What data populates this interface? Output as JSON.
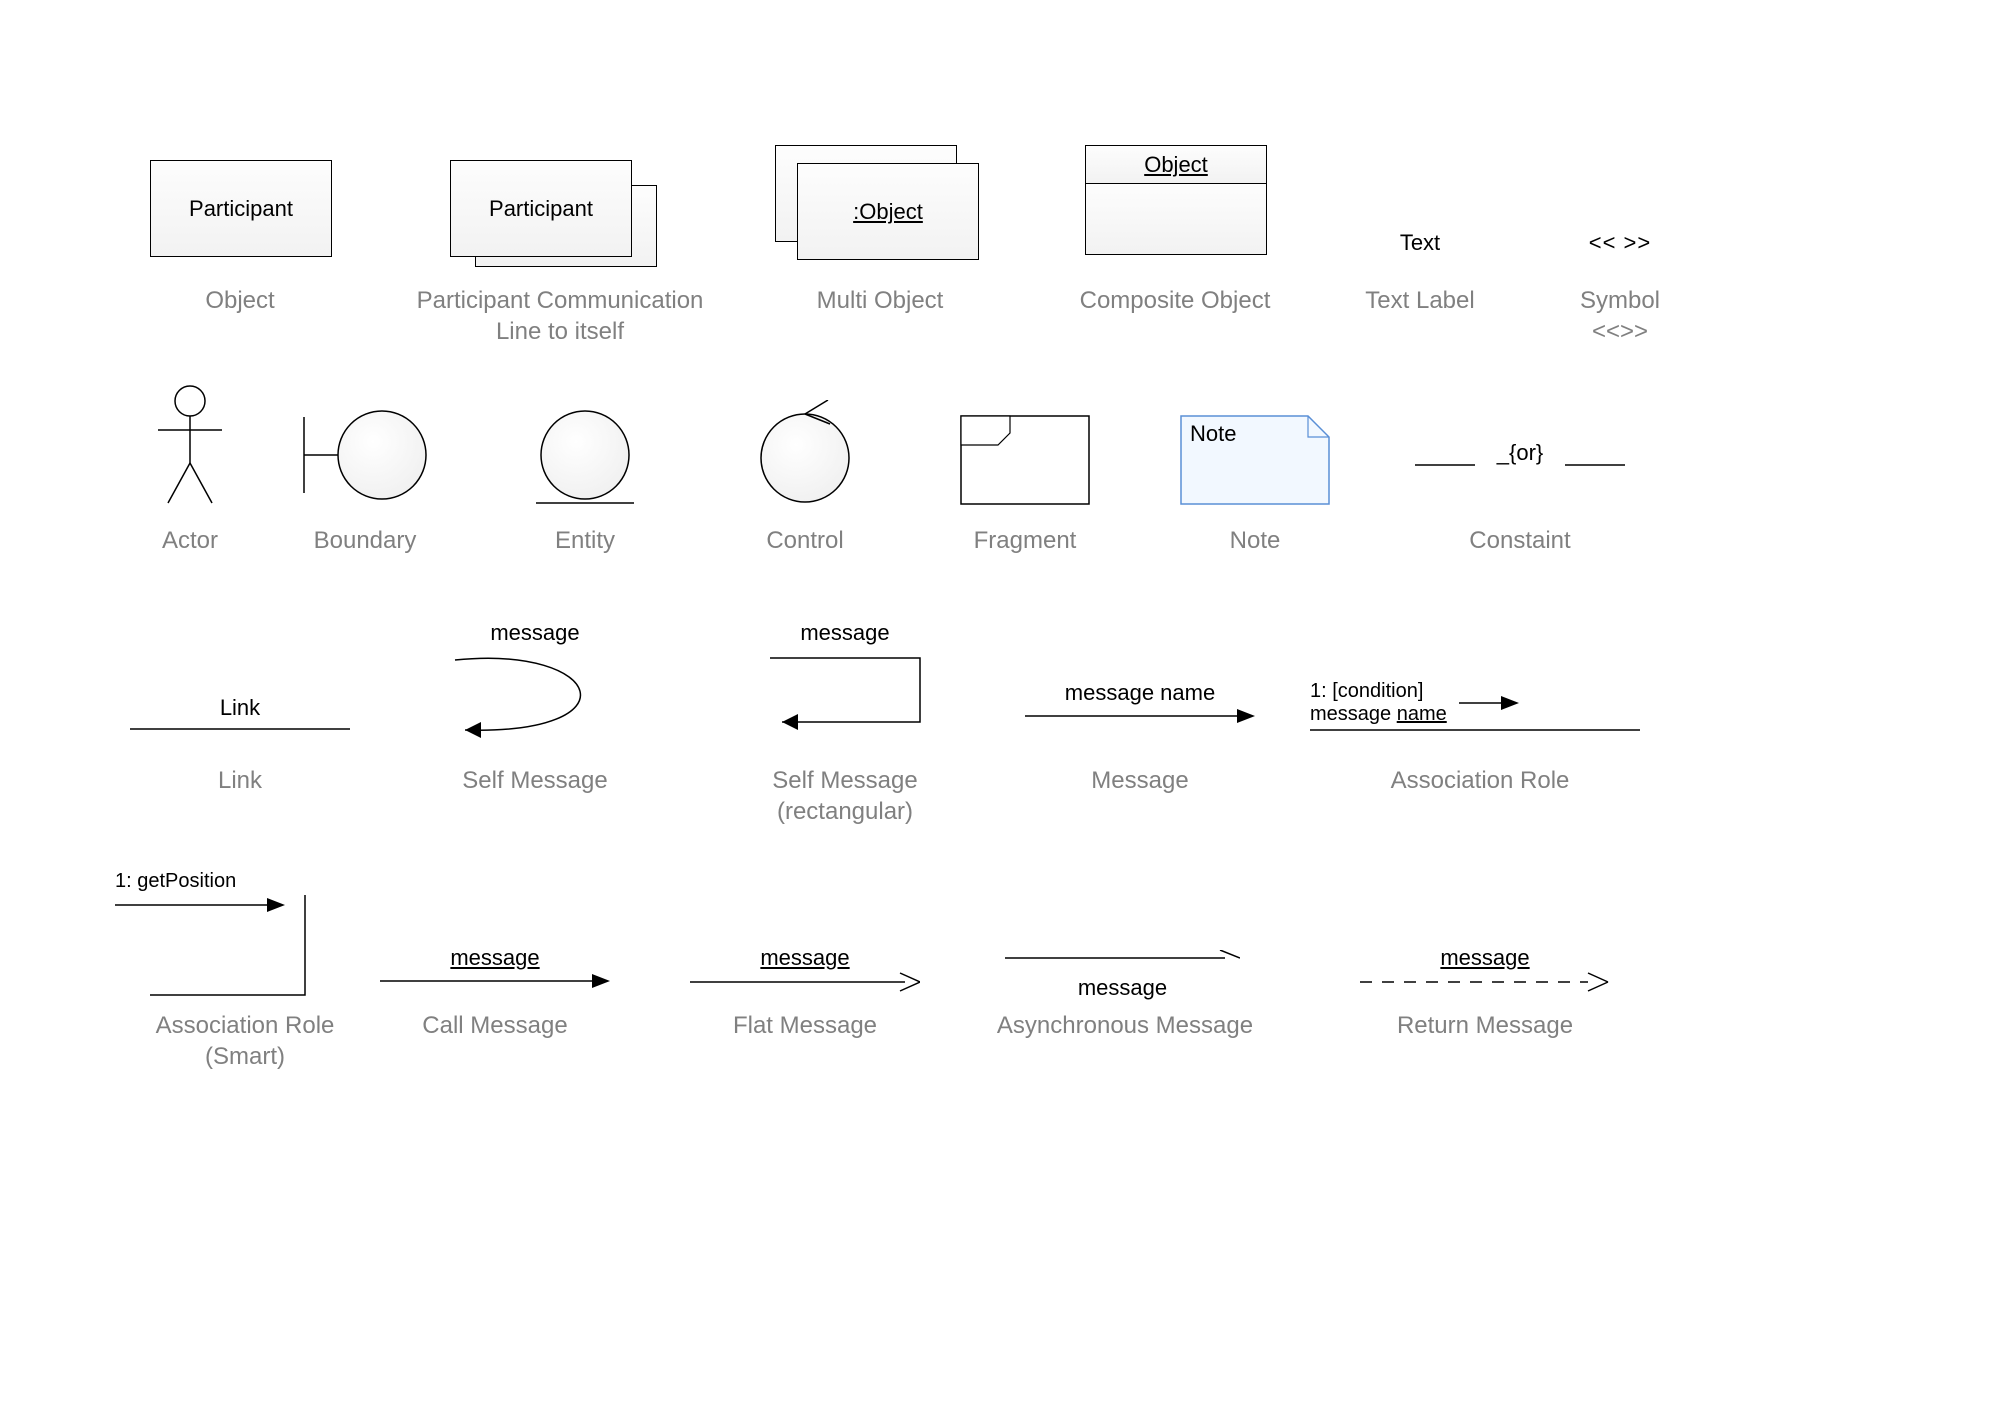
{
  "row1": {
    "object": {
      "shape_text": "Participant",
      "caption": "Object"
    },
    "participant": {
      "shape_text": "Participant",
      "caption": "Participant Communication\nLine to itself"
    },
    "multi_object": {
      "shape_text": ":Object",
      "caption": "Multi Object"
    },
    "composite": {
      "shape_text": "Object",
      "caption": "Composite Object"
    },
    "text_label": {
      "shape_text": "Text",
      "caption": "Text Label"
    },
    "symbol": {
      "shape_text": "<< >>",
      "caption": "Symbol\n<<>>"
    }
  },
  "row2": {
    "actor": {
      "caption": "Actor"
    },
    "boundary": {
      "caption": "Boundary"
    },
    "entity": {
      "caption": "Entity"
    },
    "control": {
      "caption": "Control"
    },
    "fragment": {
      "caption": "Fragment"
    },
    "note": {
      "shape_text": "Note",
      "caption": "Note"
    },
    "constraint": {
      "shape_text": "_{or}",
      "caption": "Constaint"
    }
  },
  "row3": {
    "link": {
      "shape_text": "Link",
      "caption": "Link"
    },
    "self_msg": {
      "shape_text": "message",
      "caption": "Self Message"
    },
    "self_msg_rect": {
      "shape_text": "message",
      "caption": "Self Message\n(rectangular)"
    },
    "message": {
      "shape_text": "message name",
      "caption": "Message"
    },
    "assoc_role": {
      "line1": "1: [condition]",
      "line2_pre": "message ",
      "line2_u": "name",
      "caption": "Association Role"
    }
  },
  "row4": {
    "assoc_smart": {
      "shape_text": "1: getPosition",
      "caption": "Association Role\n(Smart)"
    },
    "call": {
      "shape_text": "message",
      "caption": "Call Message"
    },
    "flat": {
      "shape_text": "message",
      "caption": "Flat Message"
    },
    "async": {
      "shape_text": "message",
      "caption": "Asynchronous Message"
    },
    "return": {
      "shape_text": "message",
      "caption": "Return Message"
    }
  }
}
